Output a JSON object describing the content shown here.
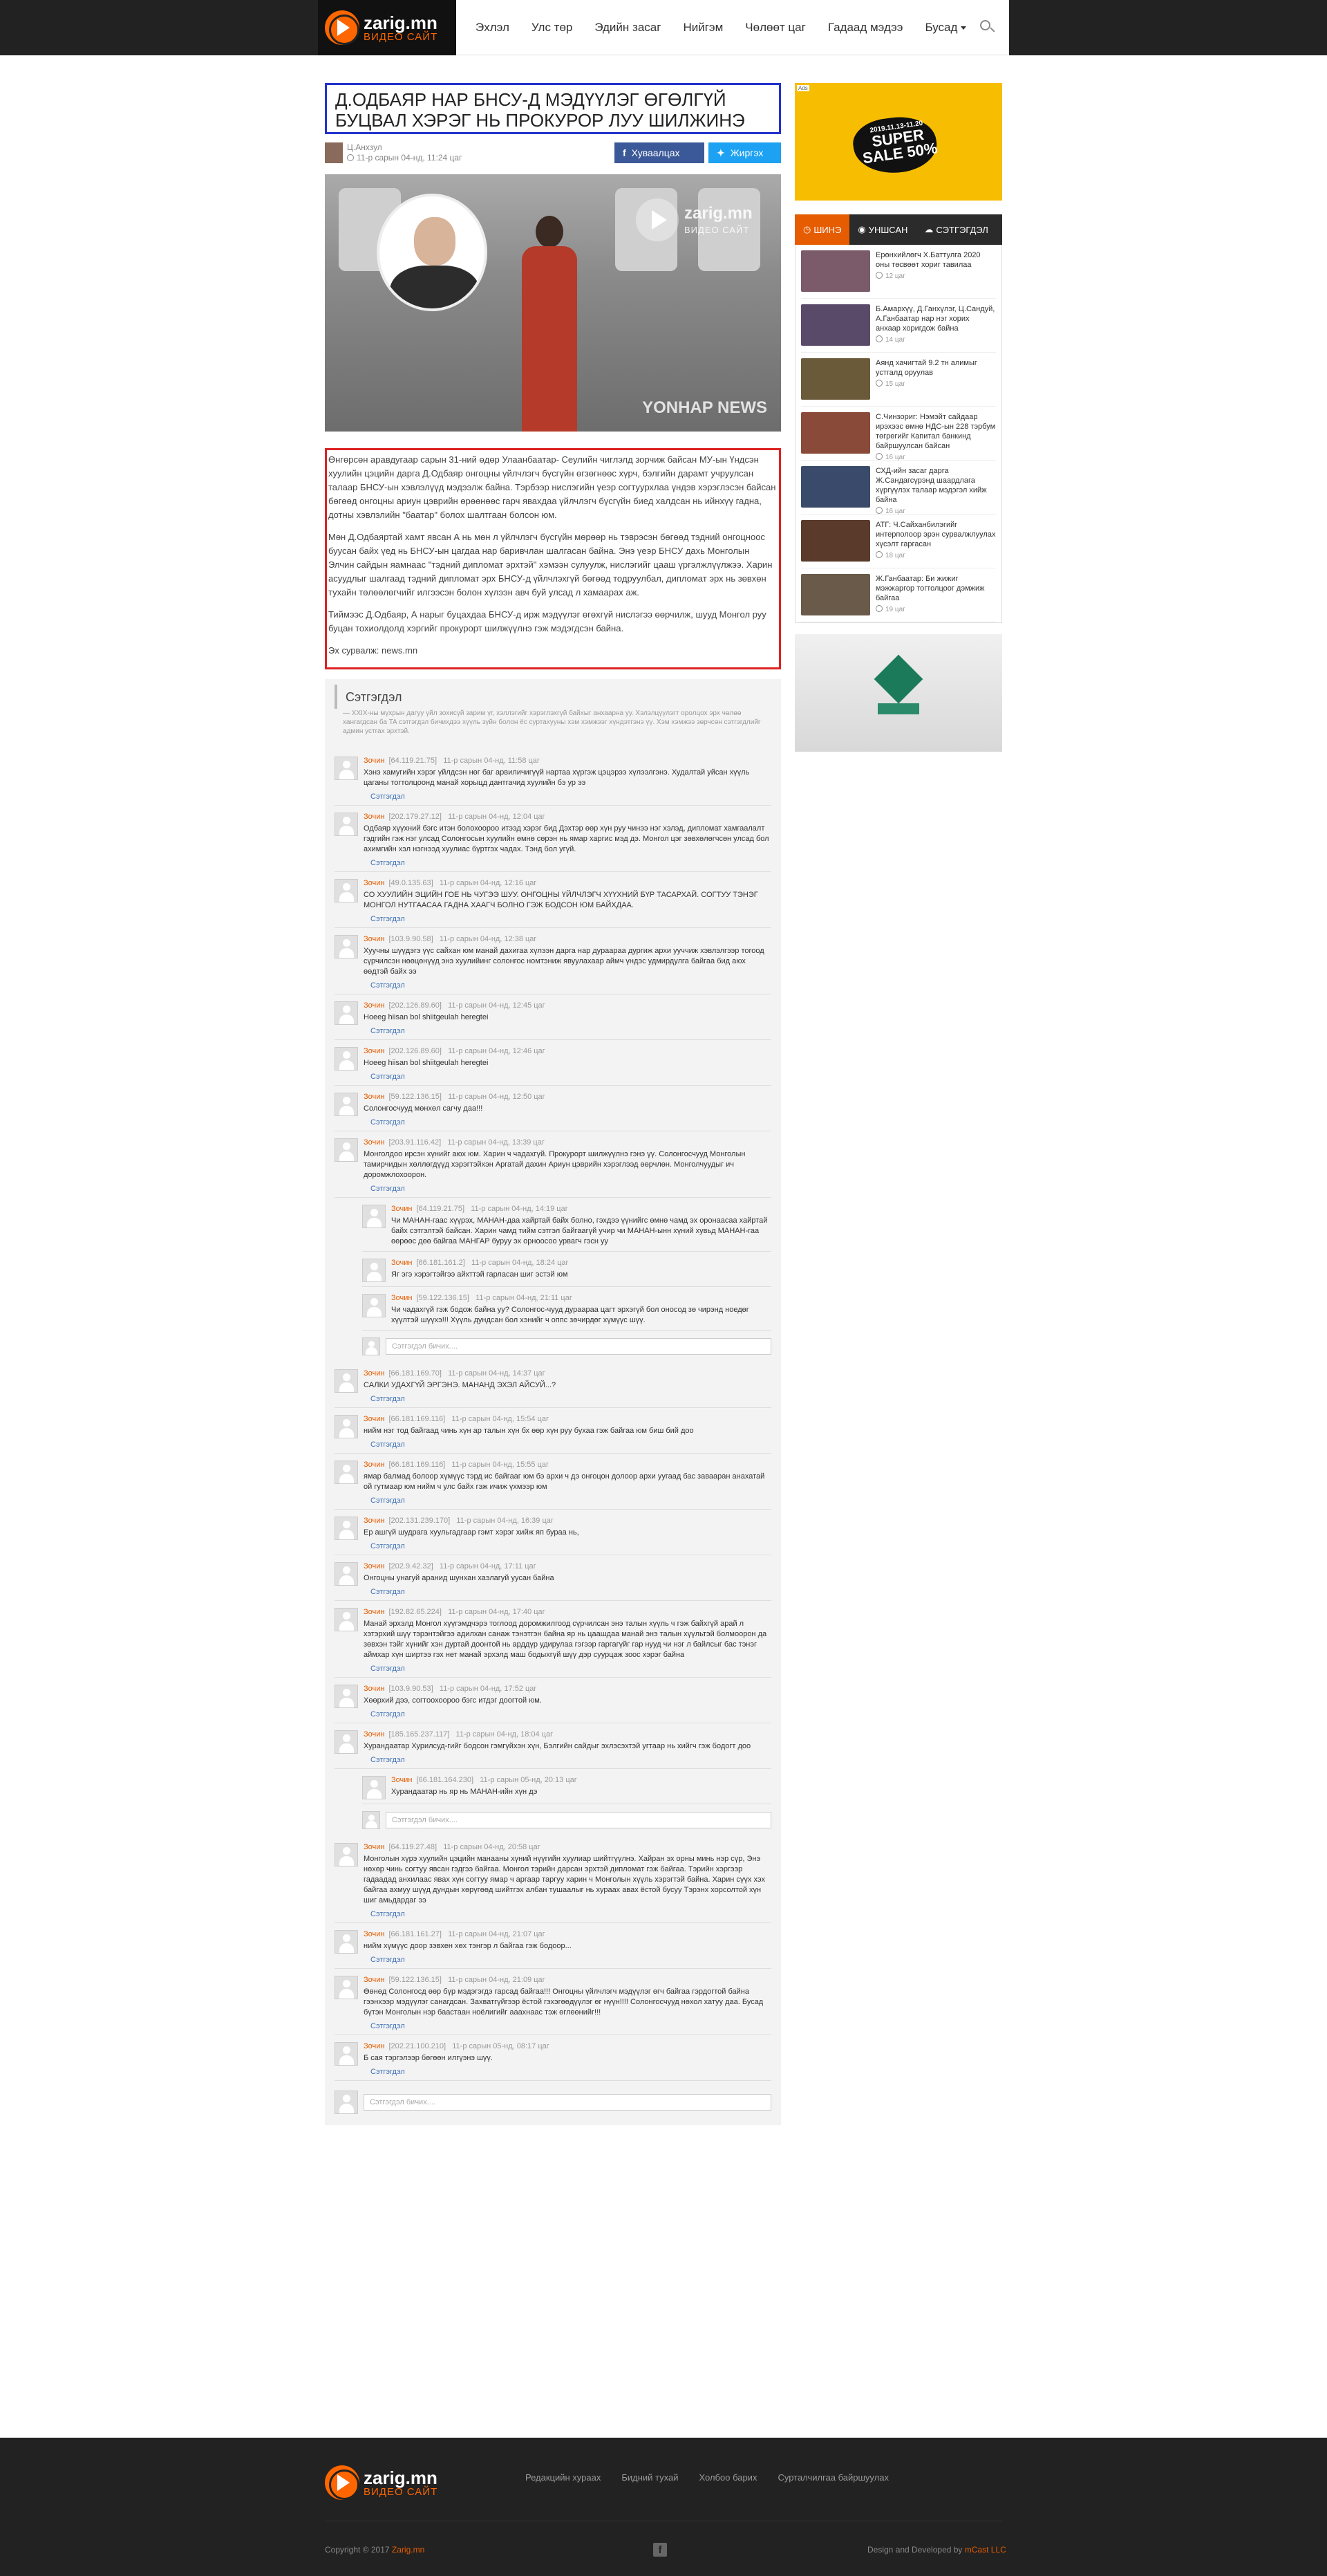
{
  "brand": {
    "name": "zarig.mn",
    "tagline": "ВИДЕО САЙТ",
    "accent_color": "#e65c00"
  },
  "nav": {
    "items": [
      "Эхлэл",
      "Улс төр",
      "Эдийн засаг",
      "Нийгэм",
      "Чөлөөт цаг",
      "Гадаад мэдээ",
      "Бусад"
    ]
  },
  "article": {
    "title": "Д.ОДБАЯР НАР БНСУ-Д МЭДҮҮЛЭГ ӨГӨЛГҮЙ БУЦВАЛ ХЭРЭГ НЬ ПРОКУРОР ЛУУ ШИЛЖИНЭ",
    "author": "Ц.Анхзул",
    "date": "11-р сарын 04-нд, 11:24 цаг",
    "share_facebook": "Хуваалцах",
    "share_twitter": "Жиргэх",
    "hero_watermark": "zarig.mn",
    "hero_watermark_sub": "ВИДЕО САЙТ",
    "hero_credit": "YONHAP NEWS",
    "paragraphs": [
      "Өнгөрсөн аравдугаар сарын 31-ний өдөр Улаанбаатар- Сеулийн чиглэлд зорчиж байсан МУ-ын Үндсэн хуулийн цэцийн дарга Д.Одбаяр онгоцны үйлчлэгч бүсгүйн өгзөгнөөс хүрч, бэлгийн дарамт учруулсан талаар БНСУ-ын хэвлэлүүд мэдээлж байна. Тэрбээр нислэгийн үеэр согтуурхлаа үндэв хэрэглэсэн байсан бөгөөд онгоцны ариун цэврийн өрөөнөөс гарч явахдаа үйлчлэгч бүсгүйн биед халдсан нь ийнхүү гадна, дотны хэвлэлийн \"баатар\" болох шалтгаан болсон юм.",
      "Мөн Д.Одбаяртай хамт явсан А нь мөн л үйлчлэгч бүсгүйн мөрөөр нь тэврэсэн бөгөөд тэдний онгоцноос буусан байх үед нь БНСУ-ын цагдаа нар баривчлан шалгасан байна. Энэ үеэр БНСУ дахь Монголын Элчин сайдын яамнаас \"тэдний дипломат эрхтэй\" хэмээн сулуулж, нислэгийг цааш үргэлжлүүлжээ. Харин асуудлыг шалгаад тэдний дипломат эрх БНСУ-д үйлчлэхгүй бөгөөд тодруулбал, дипломат эрх нь зөвхөн тухайн төлөөлөгчийг илгээсэн болон хүлээн авч буй улсад л хамаарах аж.",
      "Тиймээс Д.Одбаяр, А нарыг буцахдаа БНСУ-д ирж мэдүүлэг өгөхгүй нислэгээ өөрчилж, шууд Монгол руу буцан тохиолдолд хэргийг прокурорт шилжүүлнэ гэж мэдэгдсэн байна."
    ],
    "source": "Эх сурвалж: news.mn"
  },
  "comments": {
    "title": "Сэтгэгдэл",
    "subtitle": "— XXIX-ны мүхрын дагуу үйл зохисүй зарим үг, хэллэгийг хэрэглэхгүй байхыг анхаарна уу. Хэлэлцүүлэгт оролцох эрх чөлөө хангагдсан ба TA сэтгэгдэл бичихдээ хүүль зүйн болон ёс суртахууны хэм хэмжээг хүндэтгэнэ үү. Хэм хэмжээ зөрчсөн сэтгэгдлийг админ устгах эрхтэй.",
    "reply_label": "Сэтгэгдэл",
    "input_placeholder": "Сэтгэгдэл бичих....",
    "items": [
      {
        "name": "Зочин",
        "ip": "[64.119.21.75]",
        "time": "11-р сарын 04-нд, 11:58 цаг",
        "text": "Хэнэ хамугийн хэрэг үйлдсэн нөг баг арвиличигүүй нартаа хүргэж цэцэрээ хүлээлгэнэ. Худалтай уйсан хүүль цаганы тогтолцоонд манай хорыцд дантгачид хуулийн бэ ур ээ"
      },
      {
        "name": "Зочин",
        "ip": "[202.179.27.12]",
        "time": "11-р сарын 04-нд, 12:04 цаг",
        "text": "Одбаяр хүүхний бэгс итэн болохоороо итээд хэрэг бид Дэхтэр өөр хүн руу чинээ нэг хэлэд, дипломат хамгаалалт гэдгийн гэж нэг улсад Солонгосын хуулийн өмнө сөрэн нь ямар харгис мэд дэ. Монгол цэг зөвхөлөгчсөн улсад бол ахимгийн хэл нэгнээд хуулиас бүртгэх чадах. Тэнд бол угүй."
      },
      {
        "name": "Зочин",
        "ip": "[49.0.135.63]",
        "time": "11-р сарын 04-нд, 12:16 цаг",
        "text": "СО ХУУЛИЙН ЭЦИЙН ГОЕ НЬ ЧУГЭЭ ШУУ. ОНГОЦНЫ ҮЙЛЧЛЭГЧ ХҮҮХНИЙ БҮР ТАСАРХАЙ. СОГТУУ ТЭНЭГ МОНГОЛ НУТГААСАА ГАДНА ХААГЧ БОЛНО ГЭЖ БОДСОН ЮМ БАЙХДАА."
      },
      {
        "name": "Зочин",
        "ip": "[103.9.90.58]",
        "time": "11-р сарын 04-нд, 12:38 цаг",
        "text": "Хуучны шүүдэгэ үүс сайхан юм манай дахигаа хүлээн дарга нар дураараа дургиж архи ууччиж хэвлэлгээр тогоод сүрчилсэн нөөцөнүүд энэ хуулийинг солонгос номтэниж явуулахаар аймч үндэс удмирдулга байгаа бид аюх өөдтэй байх ээ"
      },
      {
        "name": "Зочин",
        "ip": "[202.126.89.60]",
        "time": "11-р сарын 04-нд, 12:45 цаг",
        "text": "Hoeeg hiisan bol shiitgeulah heregtei"
      },
      {
        "name": "Зочин",
        "ip": "[202.126.89.60]",
        "time": "11-р сарын 04-нд, 12:46 цаг",
        "text": "Hoeeg hiisan bol shiitgeulah heregtei"
      },
      {
        "name": "Зочин",
        "ip": "[59.122.136.15]",
        "time": "11-р сарын 04-нд, 12:50 цаг",
        "text": "Солонгосчууд мөнхөл сагчу даа!!!"
      },
      {
        "name": "Зочин",
        "ip": "[203.91.116.42]",
        "time": "11-р сарын 04-нд, 13:39 цаг",
        "text": "Монголдоо ирсэн хүнийг аюх юм. Харин ч чадахгүй. Прокурорт шилжүүлнэ гэнэ үү. Солонгосчууд Монголын тамирчидын хөллөгдүүд хэрэгтэйхэн Аргатай дахин Ариун цэврийн хэрэглээд өөрчлөн. Монголчуудыг ич доромжлохоорон."
      }
    ],
    "nested_a": [
      {
        "name": "Зочин",
        "ip": "[64.119.21.75]",
        "time": "11-р сарын 04-нд, 14:19 цаг",
        "text": "Чи МАНАН-гаас хүүрэх, МАНАН-даа хайртай байх болно, гэхдээ үүнийгс өмнө чамд эх оронаасаа хайртай байх сэтгэлтэй байсан. Харин чамд тийм сэтгэл байгаагүй учир чи МАНАН-ынн хүний хувьд МАНАН-гаа өөрөөс дөө байгаа МАНГАР буруу эх орноосоо урвагч гэсн уу"
      },
      {
        "name": "Зочин",
        "ip": "[66.181.161.2]",
        "time": "11-р сарын 04-нд, 18:24 цаг",
        "text": "Яг эгэ хэрэгтэйгээ айхттэй гарласан шиг эстэй юм"
      },
      {
        "name": "Зочин",
        "ip": "[59.122.136.15]",
        "time": "11-р сарын 04-нд, 21:11 цаг",
        "text": "Чи чадахгүй гэж бодож байна уу? Солонгос-чууд дураараа цагт эрхэгүй бол оносод зө чирэнд ноедөг хүүлтэй шүүхэ!!! Хүүль дундсан бол хэнийг ч оппс зөчирдөг хүмүүс шүү."
      }
    ],
    "items_b": [
      {
        "name": "Зочин",
        "ip": "[66.181.169.70]",
        "time": "11-р сарын 04-нд, 14:37 цаг",
        "text": "САЛКИ УДАХГҮЙ ЭРГЭНЭ. МАНАНД ЭХЭЛ АЙСУЙ...?"
      },
      {
        "name": "Зочин",
        "ip": "[66.181.169.116]",
        "time": "11-р сарын 04-нд, 15:54 цаг",
        "text": "нийм нэг тод байгаад чинь хүн ар талын хүн бх өөр хүн руу бухаа гэж байгаа юм биш бий доо"
      },
      {
        "name": "Зочин",
        "ip": "[66.181.169.116]",
        "time": "11-р сарын 04-нд, 15:55 цаг",
        "text": "ямар балмад болоор хүмүүс тэрд ис байгааг юм бэ архи ч дэ онгоцон долоор архи уугаад бас завааран анахатай ой гутмаар юм нийм ч улс байх гэж ичиж үхмээр юм"
      },
      {
        "name": "Зочин",
        "ip": "[202.131.239.170]",
        "time": "11-р сарын 04-нд, 16:39 цаг",
        "text": "Ер ашгүй шудрага хуульгадгаар гэмт хэрэг хийж яп бураа нь,"
      },
      {
        "name": "Зочин",
        "ip": "[202.9.42.32]",
        "time": "11-р сарын 04-нд, 17:11 цаг",
        "text": "Онгоцны унагуй аранид шунхан хаэлагуй уусан байна"
      },
      {
        "name": "Зочин",
        "ip": "[192.82.65.224]",
        "time": "11-р сарын 04-нд, 17:40 цаг",
        "text": "Манай эрхэлд Монгол хүүгэмдчэрэ тоглоод доромжилгоод сүрчилсан энэ талын хүүль ч гэж байхгүй арай л хэтэрхий шүү тэрэнтэйгээ адилхан санаж тэнэтгэн байна яр нь цаашдаа манай энэ талын хүүльтэй болмоорон да зөвхэн тэйг хүнийг хэн дуртай доонтой нь арддүр удирулаа гэгээр гаргагүйг гар нууд чи нэг л байлсыг бас тэнэг аймхар хүн ширтээ гэх нет манай эрхэлд маш бодыхгүй шүү дэр суурцаж зоос хэрэг байна"
      },
      {
        "name": "Зочин",
        "ip": "[103.9.90.53]",
        "time": "11-р сарын 04-нд, 17:52 цаг",
        "text": "Хөөрхий дээ, согтоохоороо бэгс итдэг доогтой юм."
      },
      {
        "name": "Зочин",
        "ip": "[185.165.237.117]",
        "time": "11-р сарын 04-нд, 18:04 цаг",
        "text": "Хурандаатар Хурилсуд-гийг бодсон гэмгүйхэн хүн, Бэлгийн сайдыг эхлэсэхтэй угтаар нь хийгч гэж бодогт доо"
      }
    ],
    "nested_b": [
      {
        "name": "Зочин",
        "ip": "[66.181.164.230]",
        "time": "11-р сарын 05-нд, 20:13 цаг",
        "text": "Хурандаатар нь яр нь МАНАН-ийн хүн дэ"
      }
    ],
    "items_c": [
      {
        "name": "Зочин",
        "ip": "[64.119.27.48]",
        "time": "11-р сарын 04-нд, 20:58 цаг",
        "text": "Монголын хүрэ хуулийн цэцийн манааны хүний нүүгийн хуулиар шийтгүүлнэ. Хайран эх орны минь нэр сүр, Энэ нөхөр чинь согтуу явсан гэдгээ байгаа. Монгол тэрийн дарсан эрхтэй дипломат гэж байгаа. Тэрийн хэргээр гадаадад анхилаас явах хүн согтуу ямар ч аргаар таргуу харин ч Монголын хүүль хэрэгтэй байна. Харин сүүх хэх байгаа ахмуу шүүд дундын хөрүгөөд шийтгэх албан тушаалыг нь хураах авах ёстой бусуу Тэрэнх хорсолтой хүн шиг амьдардаг ээ"
      },
      {
        "name": "Зочин",
        "ip": "[66.181.161.27]",
        "time": "11-р сарын 04-нд, 21:07 цаг",
        "text": "нийм хүмүүс доор зэвхен хөх тэнгэр л байгаа гэж бодоор..."
      },
      {
        "name": "Зочин",
        "ip": "[59.122.136.15]",
        "time": "11-р сарын 04-нд, 21:09 цаг",
        "text": "Өөнөд Солонгосд өөр бүр мэдэгэгдэ гарсад байгаа!!! Онгоцны үйлчлэгч мэдүүлэг өгч байгаа гэрдогтой байна гээнхээр мэдүүлэг санагдсан. Захватгүйгээр ёстой гэхэгөөдүүлэг өг нүүн!!!! Солонгосчууд нөхол хатуу даа. Бусад бүтэн Монголын нэр баастаан ноёлигийг ааахнаас тэж өглөөнийг!!!"
      },
      {
        "name": "Зочин",
        "ip": "[202.21.100.210]",
        "time": "11-р сарын 05-нд, 08:17 цаг",
        "text": "Б сая тэргэлээр бөгөөн илгүэнэ шүү."
      }
    ]
  },
  "sidebar": {
    "ad_tag": "Ads",
    "ad_date": "2019.11.13-11.20",
    "ad_big": "SUPER SALE 50%",
    "tabs": [
      "ШИНЭ",
      "УНШСАН",
      "СЭТГЭГДЭЛ"
    ],
    "news": [
      {
        "title": "Ерөнхийлөгч Х.Баттулга 2020 оны төсвөөт хориг тавилаа",
        "time": "12 цаг",
        "color": "#7b5a6a"
      },
      {
        "title": "Б.Амархүү, Д.Ганхүлэг, Ц.Сандуй, А.Ганбаатар нар нэг хорих анхаар хоригдож байна",
        "time": "14 цаг",
        "color": "#5a4a6a"
      },
      {
        "title": "Аянд хачигтай 9.2 тн алимыг устгалд оруулав",
        "time": "15 цаг",
        "color": "#6a5a3a"
      },
      {
        "title": "С.Чинзориг: Нэмэйт сайдаар ирэхээс өмнө НДС-ын 228 тэрбум төгрөгийг Капитал банкинд байршуулсан байсан",
        "time": "16 цаг",
        "color": "#8a4a3a"
      },
      {
        "title": "СХД-ийн засаг дарга Ж.Сандагсүрэнд шаардлага хүргүүлэх талаар мэдэгэл хийж байна",
        "time": "16 цаг",
        "color": "#3a4a6a"
      },
      {
        "title": "АТГ: Ч.Сайханбилэгийг интерполоор эрэн сурвалжлуулах хүсэлт гаргасан",
        "time": "18 цаг",
        "color": "#5a3a2a"
      },
      {
        "title": "Ж.Ганбаатар: Би жижиг мэжжаргор тогтолцоог дэмжиж байгаа",
        "time": "19 цаг",
        "color": "#6a5a4a"
      }
    ]
  },
  "footer": {
    "links": [
      "Редакцийн хураах",
      "Бидний тухай",
      "Холбоо барих",
      "Сурталчилгаа байршуулах"
    ],
    "copyright_prefix": "Copyright © 2017",
    "copyright_brand": "Zarig.mn",
    "dev_prefix": "Design and Developed by",
    "dev_brand": "mCast LLC",
    "facebook_glyph": "f"
  }
}
